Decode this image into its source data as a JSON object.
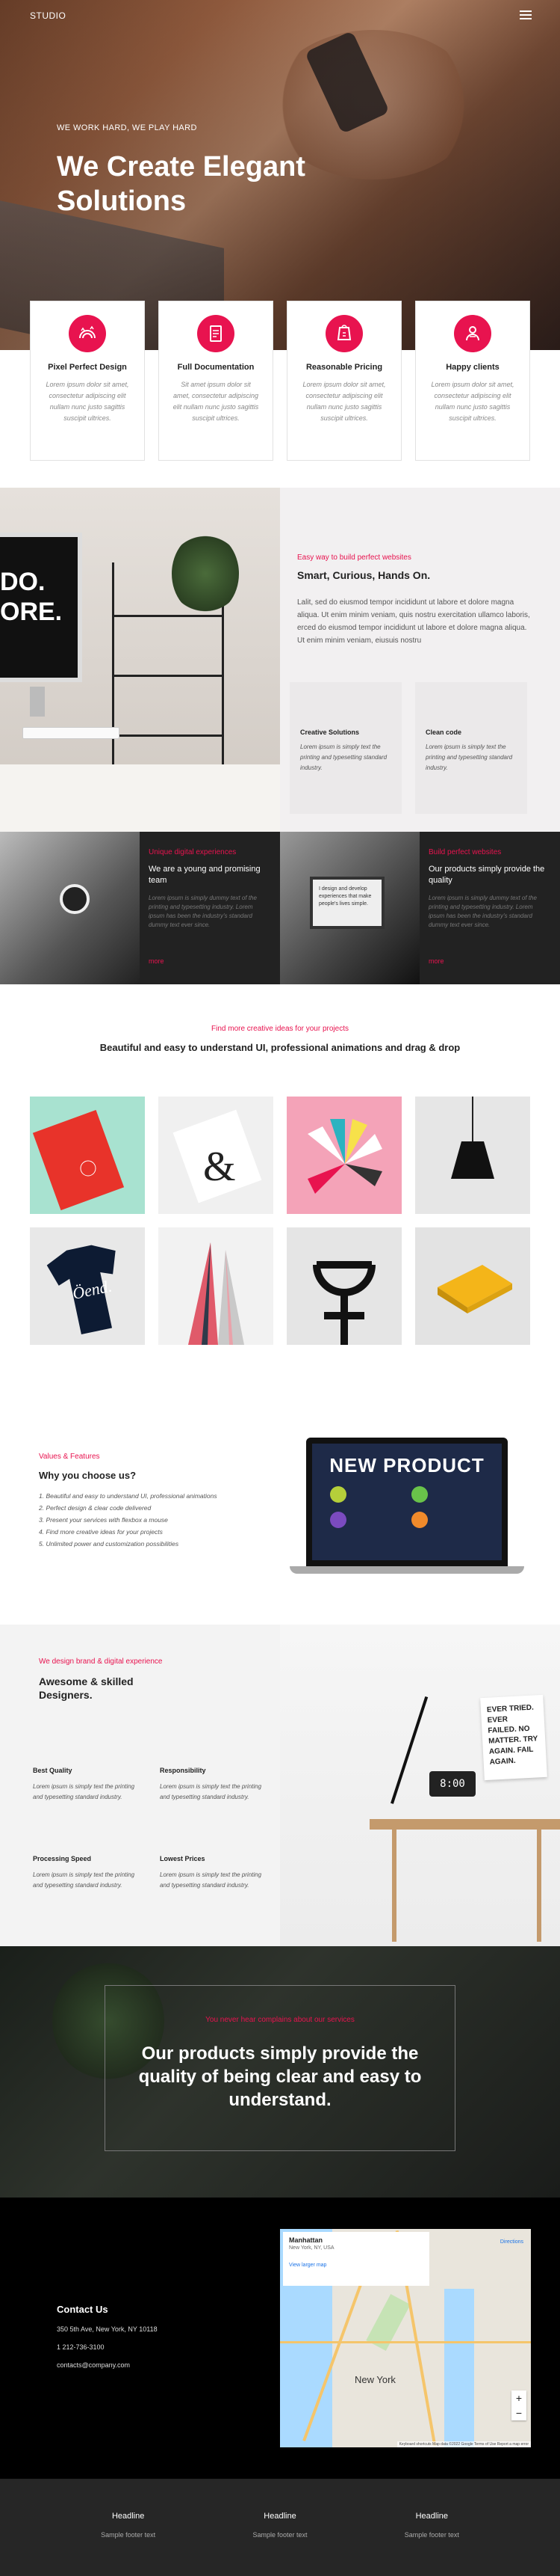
{
  "header": {
    "brand": "STUDIO"
  },
  "hero": {
    "eyebrow": "WE WORK HARD, WE PLAY HARD",
    "title": "We Create Elegant Solutions"
  },
  "features": [
    {
      "icon": "rainbow-icon",
      "title": "Pixel Perfect Design",
      "text": "Lorem ipsum dolor sit amet, consectetur adipiscing elit nullam nunc justo sagittis suscipit ultrices."
    },
    {
      "icon": "document-icon",
      "title": "Full Documentation",
      "text": "Sit amet ipsum dolor sit amet, consectetur adipiscing elit nullam nunc justo sagittis suscipit ultrices."
    },
    {
      "icon": "pricing-icon",
      "title": "Reasonable Pricing",
      "text": "Lorem ipsum dolor sit amet, consectetur adipiscing elit nullam nunc justo sagittis suscipit ultrices."
    },
    {
      "icon": "clients-icon",
      "title": "Happy clients",
      "text": "Lorem ipsum dolor sit amet, consectetur adipiscing elit nullam nunc justo sagittis suscipit ultrices."
    }
  ],
  "about": {
    "kicker": "Easy way to build perfect websites",
    "title": "Smart, Curious, Hands On.",
    "text": "Lalit, sed do eiusmod tempor incididunt ut labore et dolore magna aliqua. Ut enim minim veniam, quis nostru exercitation ullamco laboris, erced do eiusmod tempor incididunt ut labore et dolore magna aliqua. Ut enim minim veniam, eiusuis nostru",
    "monitor_text": "DO.\nORE.",
    "subs": [
      {
        "title": "Creative Solutions",
        "text": "Lorem ipsum is simply text the printing and typesetting standard industry."
      },
      {
        "title": "Clean code",
        "text": "Lorem ipsum is simply text the printing and typesetting standard industry."
      }
    ]
  },
  "split": [
    {
      "kicker": "Unique digital experiences",
      "title": "We are a young and promising team",
      "text": "Lorem ipsum is simply dummy text of the printing and typesetting industry. Lorem ipsum has been the industry's standard dummy text ever since.",
      "more": "more"
    },
    {
      "kicker": "Build perfect websites",
      "title": "Our products simply provide the quality",
      "text": "Lorem ipsum is simply dummy text of the printing and typesetting industry. Lorem ipsum has been the industry's standard dummy text ever since.",
      "more": "more"
    }
  ],
  "split_laptop_text": "I design and develop experiences that make people's lives simple.",
  "gallery": {
    "kicker": "Find more creative ideas for your projects",
    "title": "Beautiful and easy to understand UI, professional animations and drag & drop",
    "tile_shirt_text": "Öend."
  },
  "values": {
    "kicker": "Values & Features",
    "title": "Why you choose us?",
    "items": [
      "1. Beautiful and easy to understand UI, professional animations",
      "2. Perfect design & clear code delivered",
      "3. Present your services with flexbox a mouse",
      "4. Find more creative ideas for your projects",
      "5. Unlimited power and customization possibilities"
    ],
    "screen_title": "NEW PRODUCT"
  },
  "brand": {
    "kicker": "We design brand & digital experience",
    "title": "Awesome & skilled Designers.",
    "poster": "EVER TRIED. EVER FAILED. NO MATTER. TRY AGAIN. FAIL AGAIN.",
    "clock": "8:00",
    "items": [
      {
        "title": "Best Quality",
        "text": "Lorem ipsum is simply text the printing and typesetting standard industry."
      },
      {
        "title": "Responsibility",
        "text": "Lorem ipsum is simply text the printing and typesetting standard industry."
      },
      {
        "title": "Processing Speed",
        "text": "Lorem ipsum is simply text the printing and typesetting standard industry."
      },
      {
        "title": "Lowest Prices",
        "text": "Lorem ipsum is simply text the printing and typesetting standard industry."
      }
    ]
  },
  "quote": {
    "kicker": "You never hear complains about our services",
    "text": "Our products simply provide the quality of being clear and easy to understand."
  },
  "contact": {
    "title": "Contact Us",
    "address": "350 5th Ave, New York, NY 10118",
    "phone": "1 212-736-3100",
    "email": "contacts@company.com"
  },
  "map": {
    "place": "Manhattan",
    "place_sub": "New York, NY, USA",
    "link": "View larger map",
    "directions": "Directions",
    "city": "New York",
    "credits": "Keyboard shortcuts  Map data ©2022 Google  Terms of Use  Report a map error"
  },
  "footer": [
    {
      "title": "Headline",
      "text": "Sample footer text"
    },
    {
      "title": "Headline",
      "text": "Sample footer text"
    },
    {
      "title": "Headline",
      "text": "Sample footer text"
    }
  ],
  "colors": {
    "accent": "#e8134f",
    "dark": "#222222",
    "footer": "#262626"
  }
}
